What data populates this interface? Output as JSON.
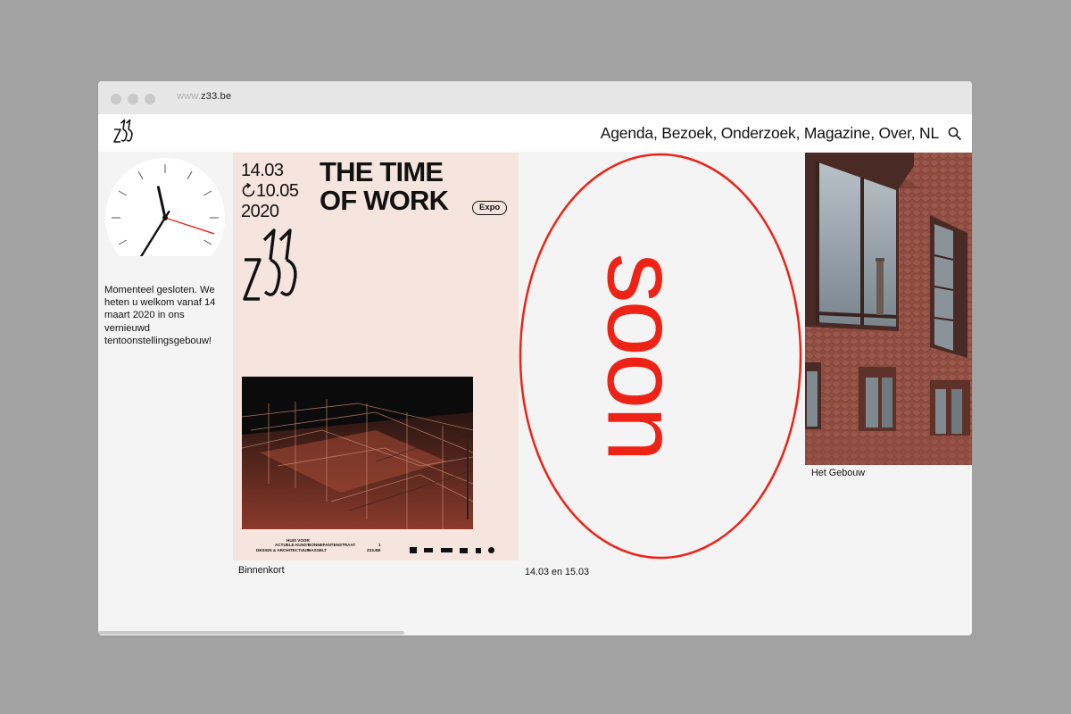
{
  "browser": {
    "url_prefix": "www.",
    "url_domain": "z33.be"
  },
  "header": {
    "logo_text": "z33",
    "nav": [
      "Agenda",
      "Bezoek",
      "Onderzoek",
      "Magazine",
      "Over",
      "NL"
    ],
    "nav_separator": ", "
  },
  "sidebar": {
    "clock": {
      "hour": 11,
      "minute": 35,
      "second": 18
    },
    "closed_text": "Momenteel gesloten. We heten u welkom vanaf 14 maart 2020 in ons vernieuwd tentoonstellingsgebouw!"
  },
  "poster": {
    "date_start": "14.03",
    "date_end": "10.05",
    "year": "2020",
    "title_line1": "THE TIME",
    "title_line2": "OF WORK",
    "badge": "Expo",
    "footer_col1": [
      "HUIS VOOR",
      "ACTUELE KUNST",
      "DESIGN & ARCHITECTUUR"
    ],
    "footer_col2": [
      "BONNEFANTENSTRAAT",
      "HASSELT"
    ],
    "footer_col3": [
      "1",
      "Z33.BE"
    ],
    "caption": "Binnenkort"
  },
  "soon": {
    "word": "soon",
    "caption": "14.03 en 15.03"
  },
  "building": {
    "caption": "Het Gebouw"
  },
  "colors": {
    "accent_red": "#ee2316",
    "poster_bg": "#f6e5de",
    "page_bg": "#f4f4f4"
  }
}
